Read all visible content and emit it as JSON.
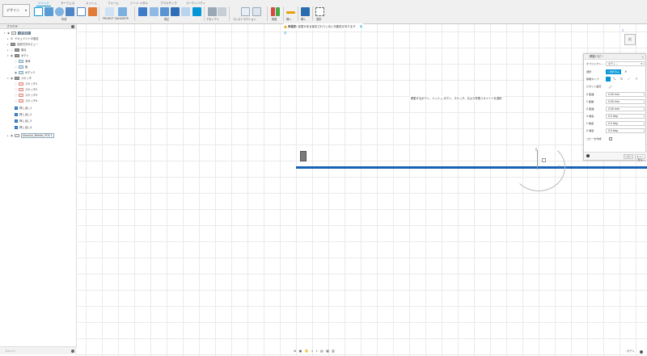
{
  "toolbar": {
    "workspace_label": "デザイン",
    "tabs": [
      "ソリッド",
      "サーフェス",
      "メッシュ",
      "フォーム",
      "シート メタル",
      "プラスチック",
      "ユーティリティ"
    ],
    "groups": {
      "create": "作成",
      "project": "PROJECT SALVADOR",
      "modify": "修正",
      "assemble": "アセンブリ",
      "construct": "コンストラクション",
      "inspect": "検査",
      "insert": "挿入",
      "select": "選択"
    }
  },
  "browser": {
    "header": "ブラウザ",
    "items": {
      "root": "(未保存)",
      "doc_settings": "ドキュメントの設定",
      "named_views": "名前付きのビュー",
      "origin": "原点",
      "bodies": "ボディ",
      "body_a": "本体",
      "body_b": "板",
      "body_c": "ボディ3",
      "sketches": "スケッチ",
      "sketch1": "スケッチ1",
      "sketch2": "スケッチ2",
      "sketch3": "スケッチ3",
      "sketch4": "スケッチ4",
      "ext1": "押し出し1",
      "ext2": "押し出し2",
      "ext3": "押し出し3",
      "ext4": "押し出し4",
      "pcb": "Akashio_Middle_PCB 1"
    },
    "comments": "コメント"
  },
  "canvas": {
    "warning_text": "変更がある保存されていない可能性があります",
    "warning_prefix": "未保存:",
    "warning_link": "保存",
    "hint": "移動するボディ、メッシュ ボディ、スケッチ、および作業ジオメトリを選択",
    "viewcube_label": "前",
    "axis_label": "Z"
  },
  "dialog": {
    "title": "移動/コピー",
    "object_label": "オブジェクト...",
    "object_value": "ボディ...",
    "select_label": "選択",
    "select_btn": "1 選択済み",
    "move_type_label": "移動タイプ",
    "pivot_label": "ピボット設定",
    "fields": [
      {
        "label": "X 距離",
        "value": "0.00 mm"
      },
      {
        "label": "Y 距離",
        "value": "0.00 mm"
      },
      {
        "label": "Z 距離",
        "value": "0.00 mm"
      },
      {
        "label": "X 角度",
        "value": "0.0 deg"
      },
      {
        "label": "Y 角度",
        "value": "0.0 deg"
      },
      {
        "label": "Z 角度",
        "value": "0.0 deg"
      }
    ],
    "copy_label": "コピーを作成",
    "ok": "OK",
    "cancel": "キャンセル"
  },
  "status": {
    "right_text": "ボディ"
  },
  "colors": {
    "accent": "#0696d7",
    "selected_line": "#1a62b6",
    "warning": "#e8a100"
  }
}
